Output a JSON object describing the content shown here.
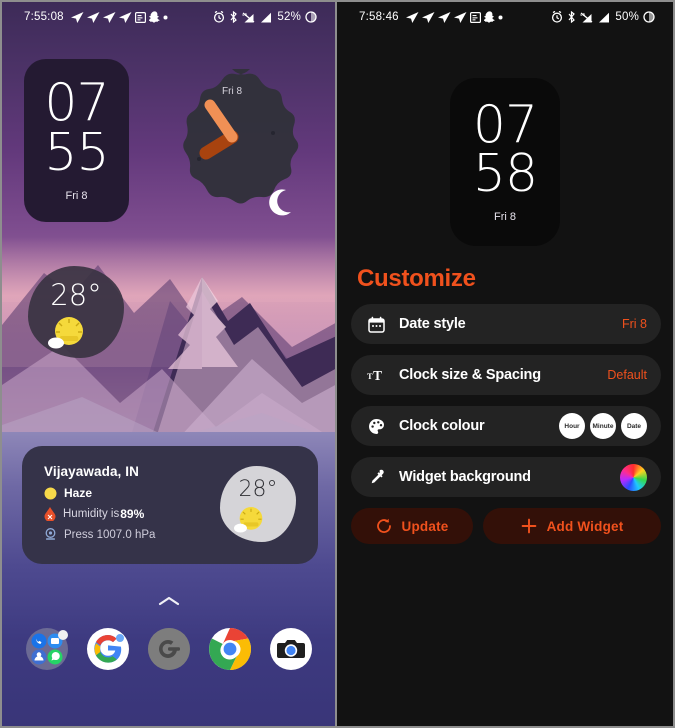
{
  "home": {
    "status_bar": {
      "time": "7:55:08",
      "battery": "52%",
      "icons": [
        "navigation-icon",
        "navigation-icon",
        "navigation-icon",
        "navigation-icon",
        "news-icon",
        "snapchat-icon",
        "dot-icon"
      ],
      "right_icons": [
        "alarm-icon",
        "bluetooth-icon",
        "mobile-data-icon",
        "signal-icon",
        "battery-icon"
      ]
    },
    "clock_widget": {
      "hours": "07",
      "minutes": "55",
      "date": "Fri 8"
    },
    "analog_widget": {
      "date": "Fri 8",
      "icon": "analog-clock-icon",
      "moon": "crescent-moon-icon"
    },
    "weather_blob": {
      "temperature": "28°",
      "icon": "sun-behind-cloud-icon"
    },
    "weather_card": {
      "city": "Vijayawada, IN",
      "condition": "Haze",
      "condition_icon": "sun-icon",
      "humidity": "Humidity is ",
      "humidity_value": "89%",
      "humidity_icon": "droplet-icon",
      "pressure": "Press 1007.0 hPa",
      "pressure_icon": "gauge-icon",
      "temperature": "28°",
      "temp_icon": "sun-behind-cloud-icon"
    },
    "app_drawer_indicator": "chevron-up-icon",
    "dock": [
      {
        "name": "app-folder",
        "icon": "folder-apps-icon"
      },
      {
        "name": "google",
        "icon": "google-icon"
      },
      {
        "name": "authenticator",
        "icon": "authenticator-icon"
      },
      {
        "name": "chrome",
        "icon": "chrome-icon"
      },
      {
        "name": "camera",
        "icon": "camera-icon"
      }
    ]
  },
  "customize": {
    "status_bar": {
      "time": "7:58:46",
      "battery": "50%"
    },
    "clock_widget": {
      "hours": "07",
      "minutes": "58",
      "date": "Fri 8"
    },
    "title": "Customize",
    "rows": [
      {
        "icon": "calendar-icon",
        "label": "Date style",
        "value": "Fri 8"
      },
      {
        "icon": "text-size-icon",
        "label": "Clock size & Spacing",
        "value": "Default"
      },
      {
        "icon": "palette-icon",
        "label": "Clock colour",
        "chips": [
          "Hour",
          "Minute",
          "Date"
        ]
      },
      {
        "icon": "eyedropper-icon",
        "label": "Widget background",
        "swatch": "color-wheel-icon"
      }
    ],
    "buttons": [
      {
        "icon": "refresh-icon",
        "label": "Update"
      },
      {
        "icon": "plus-icon",
        "label": "Add Widget"
      }
    ]
  },
  "colors": {
    "accent": "#f0511d",
    "row_bg": "#232323",
    "panel_bg": "#121212",
    "button_bg": "#331008"
  }
}
